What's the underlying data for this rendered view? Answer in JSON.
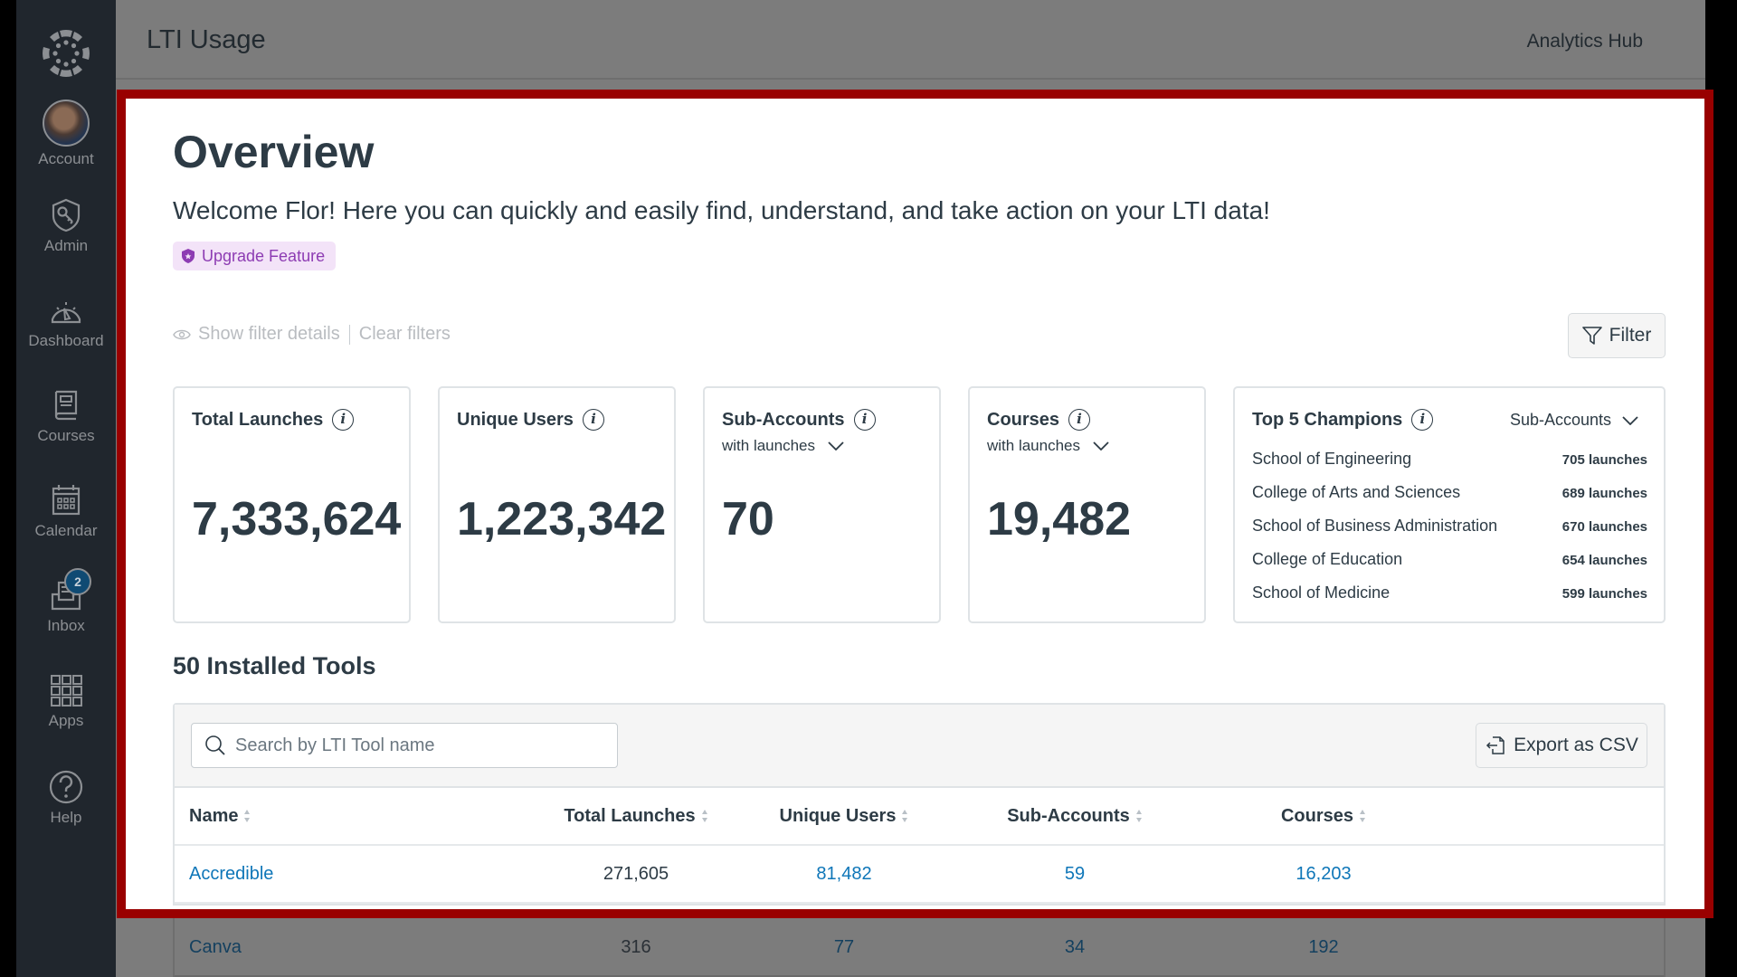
{
  "nav": {
    "items": [
      {
        "label": "Account",
        "icon": "avatar"
      },
      {
        "label": "Admin",
        "icon": "shield-key-icon"
      },
      {
        "label": "Dashboard",
        "icon": "dashboard-gauge-icon"
      },
      {
        "label": "Courses",
        "icon": "book-icon"
      },
      {
        "label": "Calendar",
        "icon": "calendar-icon"
      },
      {
        "label": "Inbox",
        "icon": "inbox-icon",
        "badge": "2"
      },
      {
        "label": "Apps",
        "icon": "apps-grid-icon"
      },
      {
        "label": "Help",
        "icon": "help-icon"
      }
    ]
  },
  "header": {
    "title": "LTI Usage",
    "right_link": "Analytics Hub"
  },
  "overview": {
    "title": "Overview",
    "welcome": "Welcome Flor! Here you can quickly and easily find, understand, and take action on your LTI data!",
    "upgrade_badge": "Upgrade Feature",
    "show_filter_details": "Show filter details",
    "clear_filters": "Clear filters",
    "filter_button": "Filter"
  },
  "colors": {
    "highlight_frame": "#990000",
    "link": "#0e76b8",
    "upgrade_text": "#8d3cb3",
    "upgrade_bg": "#f3e3f8",
    "nav_bg": "#20262d",
    "badge_bg": "#0f4a73"
  },
  "cards": [
    {
      "title": "Total Launches",
      "value": "7,333,624"
    },
    {
      "title": "Unique Users",
      "value": "1,223,342"
    },
    {
      "title": "Sub-Accounts",
      "subtitle": "with launches",
      "value": "70"
    },
    {
      "title": "Courses",
      "subtitle": "with launches",
      "value": "19,482"
    }
  ],
  "champions": {
    "title": "Top 5 Champions",
    "dropdown": "Sub-Accounts",
    "rows": [
      {
        "name": "School of Engineering",
        "value": "705 launches"
      },
      {
        "name": "College of Arts and Sciences",
        "value": "689 launches"
      },
      {
        "name": "School of Business Administration",
        "value": "670 launches"
      },
      {
        "name": "College of Education",
        "value": "654 launches"
      },
      {
        "name": "School of Medicine",
        "value": "599 launches"
      }
    ]
  },
  "tools": {
    "heading": "50 Installed Tools",
    "search_placeholder": "Search by LTI Tool name",
    "search_value": "",
    "export_button": "Export as CSV",
    "columns": [
      "Name",
      "Total Launches",
      "Unique Users",
      "Sub-Accounts",
      "Courses"
    ],
    "rows": [
      {
        "name": "Accredible",
        "total_launches": "271,605",
        "unique_users": "81,482",
        "sub_accounts": "59",
        "courses": "16,203"
      },
      {
        "name": "Canva",
        "total_launches": "316",
        "unique_users": "77",
        "sub_accounts": "34",
        "courses": "192"
      }
    ]
  }
}
